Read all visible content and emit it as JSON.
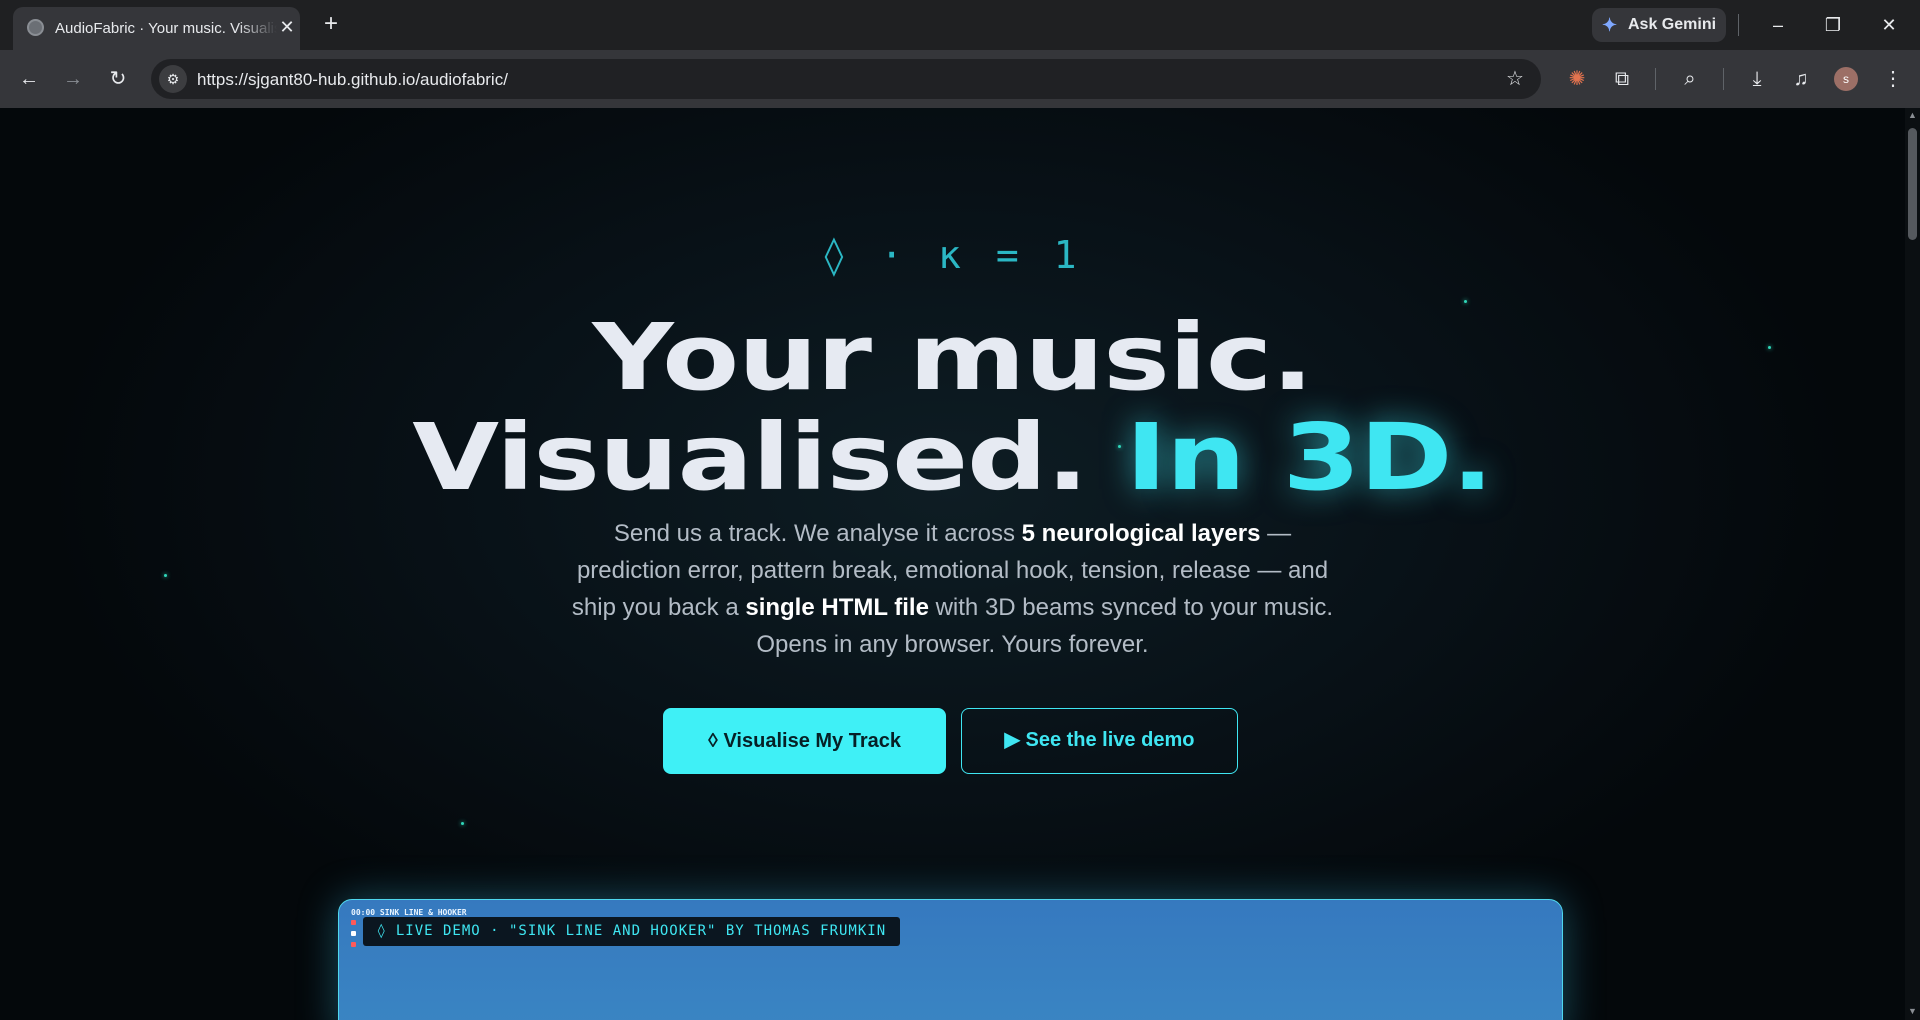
{
  "browser": {
    "tab_title": "AudioFabric · Your music. Visualised. In 3D.",
    "tab_close": "✕",
    "new_tab": "+",
    "ask_gemini": "Ask Gemini",
    "url": "https://sjgant80-hub.github.io/audiofabric/",
    "avatar_letter": "s",
    "icons": [
      "back-icon",
      "forward-icon",
      "reload-icon",
      "site-info-icon",
      "bookmark-star-icon",
      "claude-extension-icon",
      "extensions-icon",
      "tab-search-icon",
      "download-icon",
      "media-queue-icon",
      "avatar",
      "menu-icon",
      "minimize-icon",
      "restore-icon",
      "close-icon"
    ]
  },
  "hero": {
    "eyebrow": "◊ · κ = 1",
    "headline_line1": "Your music.",
    "headline_line2_part1": "Visualised.",
    "headline_line2_accent": "In 3D.",
    "lede": {
      "line1_prefix": "Send us a track. We analyse it across ",
      "line1_bold": "5 neurological layers",
      "line1_suffix": " —",
      "line2": "prediction error, pattern break, emotional hook, tension, release — and",
      "line3_prefix": "ship you back a ",
      "line3_bold": "single HTML file",
      "line3_suffix": " with 3D beams synced to your music.",
      "line4": "Opens in any browser. Yours forever."
    },
    "primary_button": "◊ Visualise My Track",
    "secondary_button": "▶ See the live demo"
  },
  "demo": {
    "hud_text": "00:00 SINK LINE & HOOKER",
    "badge": "◊ LIVE DEMO · \"SINK LINE AND HOOKER\" BY THOMAS FRUMKIN",
    "hud_dot_colors": [
      "#ff5a5a",
      "#ffffff",
      "#ff5a5a"
    ]
  },
  "colors": {
    "accent": "#3fe6f2",
    "background": "#050a0e",
    "headline": "#e6eaf2"
  }
}
